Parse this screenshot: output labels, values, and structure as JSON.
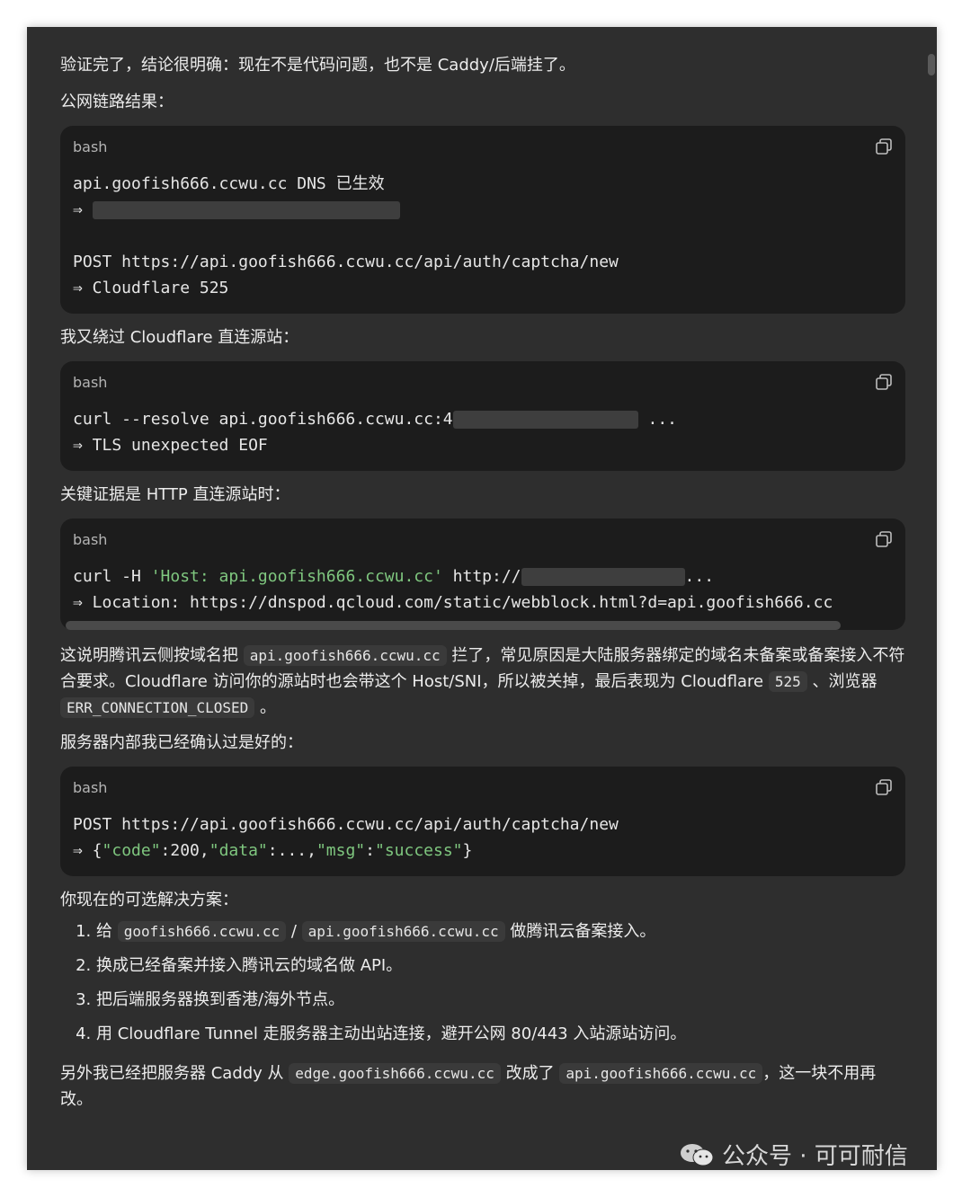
{
  "intro": "验证完了，结论很明确：现在不是代码问题，也不是 Caddy/后端挂了。",
  "public_chain_heading": "公网链路结果：",
  "blocks": [
    {
      "lang": "bash",
      "lines": [
        "api.goofish666.ccwu.cc DNS 已生效",
        "⇒",
        "",
        "POST https://api.goofish666.ccwu.cc/api/auth/captcha/new",
        "⇒ Cloudflare 525"
      ]
    },
    {
      "lang": "bash",
      "lines": [
        "curl --resolve api.goofish666.ccwu.cc:4",
        "...",
        "⇒ TLS unexpected EOF"
      ]
    },
    {
      "lang": "bash",
      "lines": [
        "curl -H ",
        "'Host: api.goofish666.ccwu.cc'",
        " http://",
        "...",
        "⇒ Location: https://dnspod.qcloud.com/static/webblock.html?d=api.goofish666.cc"
      ]
    },
    {
      "lang": "bash",
      "lines": [
        "POST https://api.goofish666.ccwu.cc/api/auth/captcha/new",
        "⇒ {",
        "\"code\"",
        ":200,",
        "\"data\"",
        ":...,",
        "\"msg\"",
        ":",
        "\"success\"",
        "}"
      ]
    }
  ],
  "bypass_heading": "我又绕过 Cloudflare 直连源站：",
  "evidence_heading": "关键证据是 HTTP 直连源站时：",
  "explain": {
    "t1": "这说明腾讯云侧按域名把",
    "code1": "api.goofish666.ccwu.cc",
    "t2": "拦了，常见原因是大陆服务器绑定的域名未备案或备案接入不符合要求。Cloudflare 访问你的源站时也会带这个 Host/SNI，所以被关掉，最后表现为 Cloudflare",
    "code2": "525",
    "t3": "、浏览器",
    "code3": "ERR_CONNECTION_CLOSED",
    "t4": "。"
  },
  "server_ok_heading": "服务器内部我已经确认过是好的：",
  "options_heading": "你现在的可选解决方案：",
  "options": {
    "o1_a": "给",
    "o1_code1": "goofish666.ccwu.cc",
    "o1_sep": "/",
    "o1_code2": "api.goofish666.ccwu.cc",
    "o1_b": "做腾讯云备案接入。",
    "o2": "换成已经备案并接入腾讯云的域名做 API。",
    "o3": "把后端服务器换到香港/海外节点。",
    "o4": "用 Cloudflare Tunnel 走服务器主动出站连接，避开公网 80/443 入站源站访问。"
  },
  "footer": {
    "t1": "另外我已经把服务器 Caddy 从",
    "code1": "edge.goofish666.ccwu.cc",
    "t2": "改成了",
    "code2": "api.goofish666.ccwu.cc",
    "t3": "，这一块不用再改。"
  },
  "watermark": "公众号 · 可可耐信"
}
